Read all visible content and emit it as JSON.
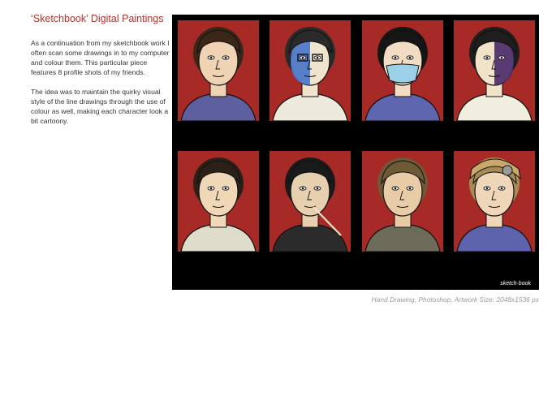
{
  "title": "‘Sketchbook’ Digital Paintings",
  "description": [
    "As a continuation from my sketchbook work I often scan some drawings in to my computer and colour them. This particular piece features 8 profile shots of my friends.",
    "The idea was to maintain the quirky visual style of the line drawings through the use of colour as well, making each character look a bit cartoony."
  ],
  "caption": "Hand Drawing, Photoshop,  Artwork Size: 2048x1536 px",
  "artwork": {
    "signature": "sketch·book",
    "background_color": "#000000",
    "portrait_background": "#a82a27",
    "portraits": [
      {
        "subject": "woman-hair-bun",
        "skin": "#efd3b3",
        "hair": "#3a2718",
        "shirt": "#5e5f9e"
      },
      {
        "subject": "man-cap-glasses-blue-face",
        "skin": "#f0e4cf",
        "paint": "#4b76c9",
        "hair": "#2a2a2a",
        "shirt": "#eee9dd"
      },
      {
        "subject": "woman-surgical-mask",
        "skin": "#f2dcc4",
        "mask": "#9bd0e8",
        "hair": "#161616",
        "shirt": "#5e66b0"
      },
      {
        "subject": "man-cap-purple-face",
        "skin": "#f1e3c8",
        "paint": "#4c2c6b",
        "hair": "#1e1e1e",
        "shirt": "#f2eedf"
      },
      {
        "subject": "man-dark-hair-profile",
        "skin": "#efd7b8",
        "hair": "#2b2119",
        "shirt": "#e0dccb"
      },
      {
        "subject": "man-with-straw",
        "skin": "#e8cfb0",
        "hair": "#1a1a1a",
        "shirt": "#2b2b2b"
      },
      {
        "subject": "man-stubble",
        "skin": "#e8cca7",
        "hair": "#6e5a36",
        "shirt": "#6d6b5a"
      },
      {
        "subject": "man-fur-hat",
        "skin": "#efd6b8",
        "hair": "#a88b54",
        "shirt": "#5d64ad"
      }
    ]
  }
}
